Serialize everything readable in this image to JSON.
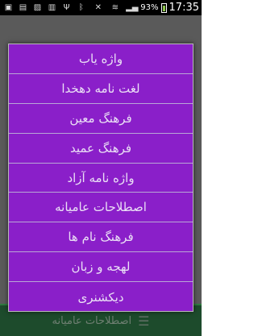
{
  "status_bar": {
    "left_icons": [
      "sim-icon",
      "document-icon",
      "image-icon",
      "sd-card-icon",
      "usb-icon"
    ],
    "battery_percent": "93%",
    "time": "17:35"
  },
  "background": {
    "bottom_bar_label": "اصطلاحات عامیانه"
  },
  "menu": {
    "items": [
      {
        "label": "واژه یاب"
      },
      {
        "label": "لغت نامه دهخدا"
      },
      {
        "label": "فرهنگ معین"
      },
      {
        "label": "فرهنگ عمید"
      },
      {
        "label": "واژه نامه آزاد"
      },
      {
        "label": "اصطلاحات عامیانه"
      },
      {
        "label": "فرهنگ نام ها"
      },
      {
        "label": "لهجه و زبان"
      },
      {
        "label": "دیکشنری"
      }
    ]
  },
  "colors": {
    "dialog_background": "#8a1fc9",
    "item_text": "#eadff5",
    "divider": "#b9a6d6",
    "bottom_bar": "#1d4b2c"
  }
}
